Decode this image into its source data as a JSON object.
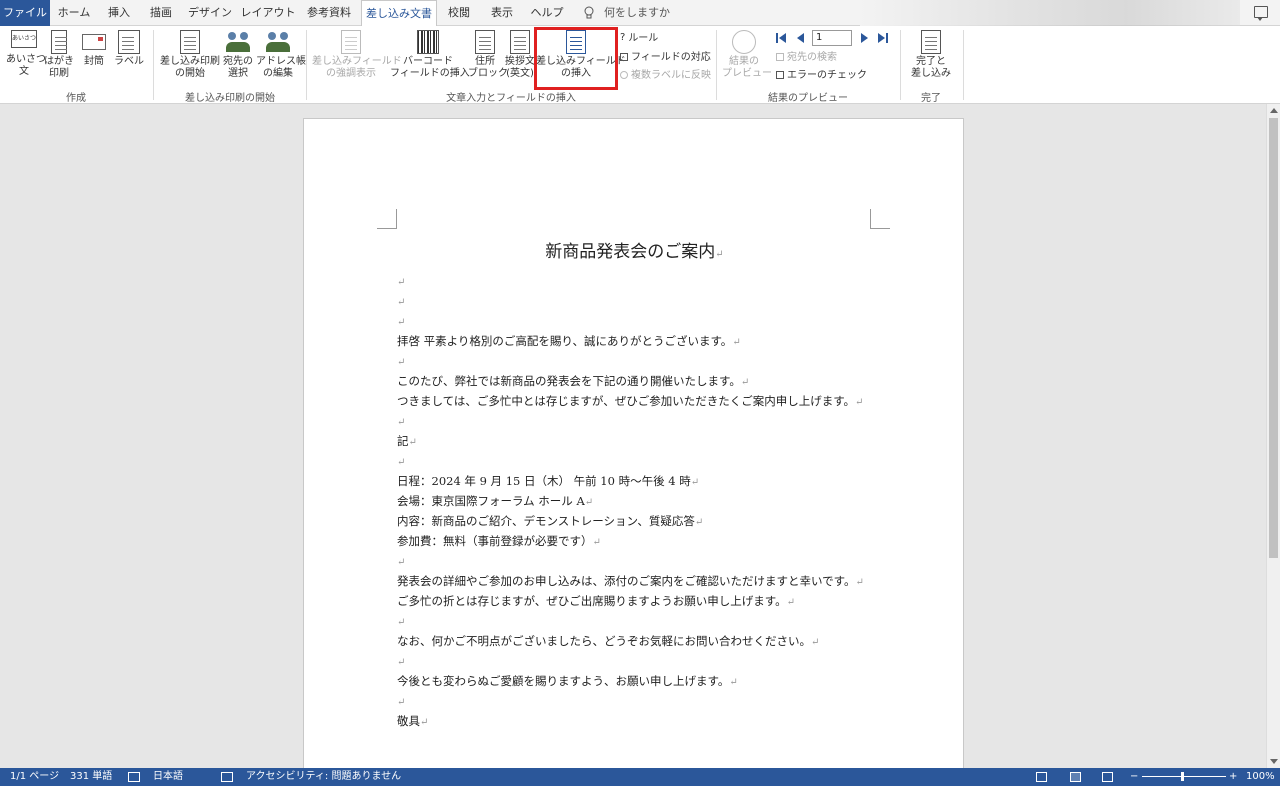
{
  "tabs": [
    {
      "label": "ファイル",
      "active": false,
      "file": true
    },
    {
      "label": "ホーム"
    },
    {
      "label": "挿入"
    },
    {
      "label": "描画"
    },
    {
      "label": "デザイン"
    },
    {
      "label": "レイアウト"
    },
    {
      "label": "参考資料"
    },
    {
      "label": "差し込み文書",
      "active": true
    },
    {
      "label": "校閲"
    },
    {
      "label": "表示"
    },
    {
      "label": "ヘルプ"
    }
  ],
  "tell_me": "何をしますか",
  "ribbon": {
    "create": {
      "label": "作成",
      "greeting": "あいさつ\n文",
      "greeting_line1": "あいさつ",
      "greeting_line2": "文",
      "postcard_line1": "はがき",
      "postcard_line2": "印刷",
      "envelope": "封筒",
      "label_btn": "ラベル",
      "icon_text": "あいさつ"
    },
    "start": {
      "label": "差し込み印刷の開始",
      "start_line1": "差し込み印刷",
      "start_line2": "の開始",
      "select_line1": "宛先の",
      "select_line2": "選択",
      "edit_line1": "アドレス帳",
      "edit_line2": "の編集"
    },
    "write": {
      "label": "文章入力とフィールドの挿入",
      "highlight_line1": "差し込みフィールド",
      "highlight_line2": "の強調表示",
      "barcode_line1": "バーコード",
      "barcode_line2": "フィールドの挿入",
      "address_line1": "住所",
      "address_line2": "ブロック",
      "greeting_line1": "挨拶文",
      "greeting_line2": "(英文)",
      "insert_line1": "差し込みフィールド",
      "insert_line2": "の挿入",
      "rules": "ルール",
      "match": "フィールドの対応",
      "update": "複数ラベルに反映"
    },
    "preview": {
      "label": "結果のプレビュー",
      "preview_line1": "結果の",
      "preview_line2": "プレビュー",
      "record": "1",
      "find": "宛先の検索",
      "check": "エラーのチェック"
    },
    "finish": {
      "label": "完了",
      "finish_line1": "完了と",
      "finish_line2": "差し込み"
    }
  },
  "document": {
    "title": "新商品発表会のご案内",
    "lines": [
      "",
      "",
      "",
      "拝啓 平素より格別のご高配を賜り、誠にありがとうございます。",
      "",
      "このたび、弊社では新商品の発表会を下記の通り開催いたします。",
      "つきましては、ご多忙中とは存じますが、ぜひご参加いただきたくご案内申し上げます。",
      "",
      "記",
      "",
      "日程：2024 年 9 月 15 日（木） 午前 10 時〜午後 4 時",
      "会場：東京国際フォーラム ホール A",
      "内容：新商品のご紹介、デモンストレーション、質疑応答",
      "参加費：無料（事前登録が必要です）",
      "",
      "発表会の詳細やご参加のお申し込みは、添付のご案内をご確認いただけますと幸いです。",
      "ご多忙の折とは存じますが、ぜひご出席賜りますようお願い申し上げます。",
      "",
      "なお、何かご不明点がございましたら、どうぞお気軽にお問い合わせください。",
      "",
      "今後とも変わらぬご愛顧を賜りますよう、お願い申し上げます。",
      "",
      "敬具"
    ],
    "paragraph_mark": "↵"
  },
  "status": {
    "page": "1/1 ページ",
    "words": "331 単語",
    "language": "日本語",
    "accessibility": "アクセシビリティ: 問題ありません",
    "zoom": "100%",
    "zoom_minus": "−",
    "zoom_plus": "+"
  },
  "colors": {
    "accent": "#2b579a",
    "highlight_box": "#e02020"
  }
}
